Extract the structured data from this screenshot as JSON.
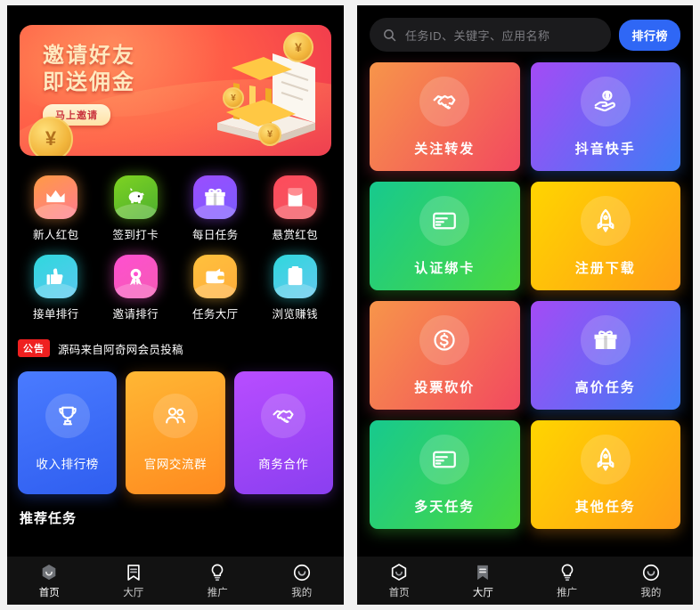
{
  "colors": {
    "app_bg": "#000000",
    "page_bg": "#f2f2f2",
    "accent_blue": "#2f67f5",
    "notice_red": "#ef2020",
    "tabbar_bg": "#121212"
  },
  "left_screen": {
    "banner": {
      "line1": "邀请好友",
      "line2": "即送佣金",
      "button_label": "马上邀请",
      "coin_symbol": "¥"
    },
    "icons": [
      {
        "label": "新人红包",
        "icon": "crown-icon",
        "c1": "#ff9a44",
        "c2": "#ff7b8f"
      },
      {
        "label": "签到打卡",
        "icon": "piggy-bank-icon",
        "c1": "#7ed321",
        "c2": "#4caf2f"
      },
      {
        "label": "每日任务",
        "icon": "gift-icon",
        "c1": "#9b4dff",
        "c2": "#7b5cff"
      },
      {
        "label": "悬赏红包",
        "icon": "red-envelope-icon",
        "c1": "#ff4b5c",
        "c2": "#f0565f"
      },
      {
        "label": "接单排行",
        "icon": "thumbs-up-icon",
        "c1": "#2fd8dd",
        "c2": "#59c8f0"
      },
      {
        "label": "邀请排行",
        "icon": "medal-icon",
        "c1": "#ff4fd0",
        "c2": "#f45bb5"
      },
      {
        "label": "任务大厅",
        "icon": "wallet-icon",
        "c1": "#ffc13c",
        "c2": "#ffad3b"
      },
      {
        "label": "浏览赚钱",
        "icon": "clipboard-icon",
        "c1": "#2fd8dd",
        "c2": "#62c8ee"
      }
    ],
    "notice": {
      "badge": "公告",
      "text": "源码来自阿奇网会员投稿"
    },
    "promos": [
      {
        "label": "收入排行榜",
        "icon": "trophy-icon",
        "c1": "#4a7bff",
        "c2": "#2f5ef0"
      },
      {
        "label": "官网交流群",
        "icon": "group-icon",
        "c1": "#ffb734",
        "c2": "#ff8a1f"
      },
      {
        "label": "商务合作",
        "icon": "handshake-icon",
        "c1": "#b84dff",
        "c2": "#8a3ff0"
      }
    ],
    "section_title": "推荐任务"
  },
  "right_screen": {
    "search": {
      "placeholder": "任务ID、关键字、应用名称",
      "value": "",
      "icon": "search-icon"
    },
    "rank_button": "排行榜",
    "tasks": [
      {
        "label": "关注转发",
        "icon": "handshake-icon",
        "c1": "#f7954a",
        "c2": "#f2495f"
      },
      {
        "label": "抖音快手",
        "icon": "hand-coin-icon",
        "c1": "#a44bf5",
        "c2": "#3d7df5"
      },
      {
        "label": "认证绑卡",
        "icon": "credit-card-icon",
        "c1": "#17c98e",
        "c2": "#4ad93f"
      },
      {
        "label": "注册下载",
        "icon": "rocket-icon",
        "c1": "#ffd500",
        "c2": "#ff9d18"
      },
      {
        "label": "投票砍价",
        "icon": "dollar-circle-icon",
        "c1": "#f7954a",
        "c2": "#f2495f"
      },
      {
        "label": "高价任务",
        "icon": "gift-icon",
        "c1": "#a44bf5",
        "c2": "#3d7df5"
      },
      {
        "label": "多天任务",
        "icon": "credit-card-icon",
        "c1": "#17c98e",
        "c2": "#4ad93f"
      },
      {
        "label": "其他任务",
        "icon": "rocket-icon",
        "c1": "#ffd500",
        "c2": "#ff9d18"
      }
    ]
  },
  "tabbar": {
    "items": [
      {
        "label": "首页",
        "icon": "home-hexagon-icon"
      },
      {
        "label": "大厅",
        "icon": "bookmark-icon"
      },
      {
        "label": "推广",
        "icon": "lightbulb-icon"
      },
      {
        "label": "我的",
        "icon": "smiley-circle-icon"
      }
    ],
    "left_active_index": 0,
    "right_active_index": 1
  }
}
